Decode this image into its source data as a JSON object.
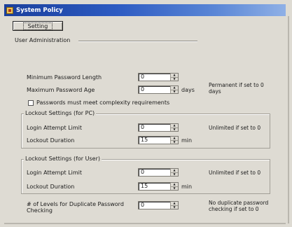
{
  "window": {
    "title": "System Policy"
  },
  "tab": {
    "label": "Setting"
  },
  "section": {
    "title": "User Administration"
  },
  "password": {
    "min_length": {
      "label": "Minimum Password Length",
      "value": "0"
    },
    "max_age": {
      "label": "Maximum Password Age",
      "value": "0",
      "unit": "days",
      "note": "Permanent if set to 0 days"
    },
    "complexity": {
      "label": "Passwords must meet complexity requirements",
      "checked": false
    }
  },
  "lockout_pc": {
    "title": "Lockout Settings (for PC)",
    "attempt_limit": {
      "label": "Login Attempt Limit",
      "value": "0",
      "note": "Unlimited if set to 0"
    },
    "duration": {
      "label": "Lockout Duration",
      "value": "15",
      "unit": "min"
    }
  },
  "lockout_user": {
    "title": "Lockout Settings (for User)",
    "attempt_limit": {
      "label": "Login Attempt Limit",
      "value": "0",
      "note": "Unlimited if set to 0"
    },
    "duration": {
      "label": "Lockout Duration",
      "value": "15",
      "unit": "min"
    }
  },
  "duplicate": {
    "label": "# of Levels for Duplicate Password Checking",
    "value": "0",
    "note": "No duplicate password checking if set to 0"
  },
  "icons": {
    "app": "system-policy-icon",
    "spin": "spin-arrows-icon"
  }
}
